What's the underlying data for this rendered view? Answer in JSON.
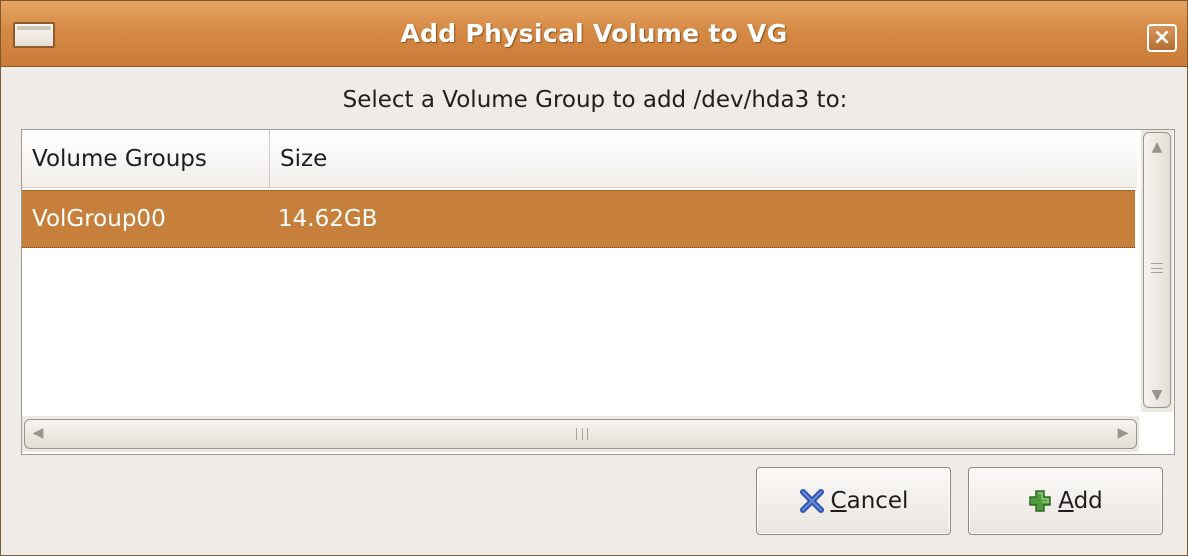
{
  "window": {
    "title": "Add Physical Volume to VG",
    "close_glyph": "×"
  },
  "prompt": "Select a Volume Group to add /dev/hda3 to:",
  "table": {
    "columns": [
      "Volume Groups",
      "Size"
    ],
    "rows": [
      {
        "volume_group": "VolGroup00",
        "size": "14.62GB",
        "selected": true
      }
    ]
  },
  "buttons": {
    "cancel": {
      "mnemonic": "C",
      "rest": "ancel",
      "icon": "cancel-x-icon",
      "icon_color": "#3a5fb8"
    },
    "add": {
      "mnemonic": "A",
      "rest": "dd",
      "icon": "plus-icon",
      "icon_color": "#4a9a3a"
    }
  },
  "colors": {
    "titlebar": "#d58a45",
    "selection": "#c7803b"
  }
}
